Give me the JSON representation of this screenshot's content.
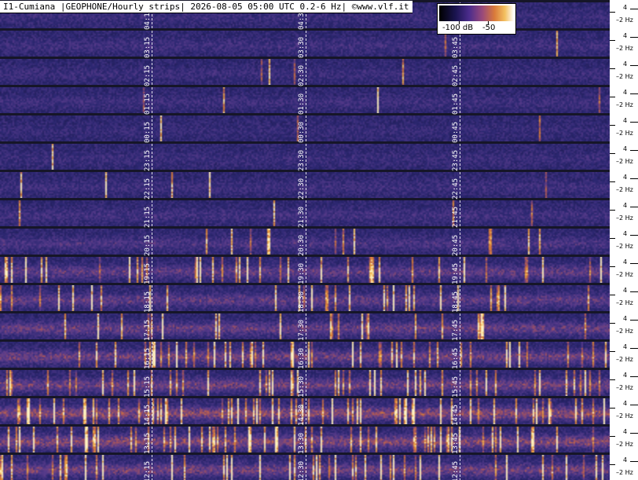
{
  "header": {
    "title": "I1-Cumiana |GEOPHONE/Hourly strips| 2026-08-05 05:00 UTC 0.2-6 Hz| ©www.vlf.it"
  },
  "colorbar": {
    "low_label": "-100 dB",
    "high_label": "-50"
  },
  "scale": {
    "upper_label": "4",
    "lower_label": "2 Hz"
  },
  "colors": {
    "background": "#161628",
    "low": "#2b2a6e",
    "mid": "#5a3a8a",
    "warm": "#c06030",
    "hot": "#f0b050"
  },
  "strips": [
    {
      "marks": [
        "04:15",
        "04:30",
        "04:45"
      ],
      "activity": 0.15,
      "bursts": 0.0
    },
    {
      "marks": [
        "03:15",
        "03:30",
        "03:45"
      ],
      "activity": 0.2,
      "bursts": 0.02
    },
    {
      "marks": [
        "02:15",
        "02:30",
        "02:45"
      ],
      "activity": 0.15,
      "bursts": 0.02
    },
    {
      "marks": [
        "01:15",
        "01:30",
        "01:45"
      ],
      "activity": 0.18,
      "bursts": 0.02
    },
    {
      "marks": [
        "00:15",
        "00:30",
        "00:45"
      ],
      "activity": 0.1,
      "bursts": 0.01
    },
    {
      "marks": [
        "23:15",
        "23:30",
        "23:45"
      ],
      "activity": 0.14,
      "bursts": 0.02
    },
    {
      "marks": [
        "22:15",
        "22:30",
        "22:45"
      ],
      "activity": 0.18,
      "bursts": 0.03
    },
    {
      "marks": [
        "21:15",
        "21:30",
        "21:45"
      ],
      "activity": 0.22,
      "bursts": 0.05
    },
    {
      "marks": [
        "20:15",
        "20:30",
        "20:45"
      ],
      "activity": 0.3,
      "bursts": 0.1
    },
    {
      "marks": [
        "19:15",
        "19:30",
        "19:45"
      ],
      "activity": 0.45,
      "bursts": 0.25
    },
    {
      "marks": [
        "18:15",
        "18:30",
        "18:45"
      ],
      "activity": 0.45,
      "bursts": 0.2
    },
    {
      "marks": [
        "17:15",
        "17:30",
        "17:45"
      ],
      "activity": 0.5,
      "bursts": 0.1
    },
    {
      "marks": [
        "16:15",
        "16:30",
        "16:45"
      ],
      "activity": 0.55,
      "bursts": 0.3
    },
    {
      "marks": [
        "15:15",
        "15:30",
        "15:45"
      ],
      "activity": 0.55,
      "bursts": 0.3
    },
    {
      "marks": [
        "14:15",
        "14:30",
        "14:45"
      ],
      "activity": 0.7,
      "bursts": 0.45
    },
    {
      "marks": [
        "13:15",
        "13:30",
        "13:45"
      ],
      "activity": 0.65,
      "bursts": 0.4
    },
    {
      "marks": [
        "12:15",
        "12:30",
        "12:45"
      ],
      "activity": 0.55,
      "bursts": 0.3
    }
  ]
}
